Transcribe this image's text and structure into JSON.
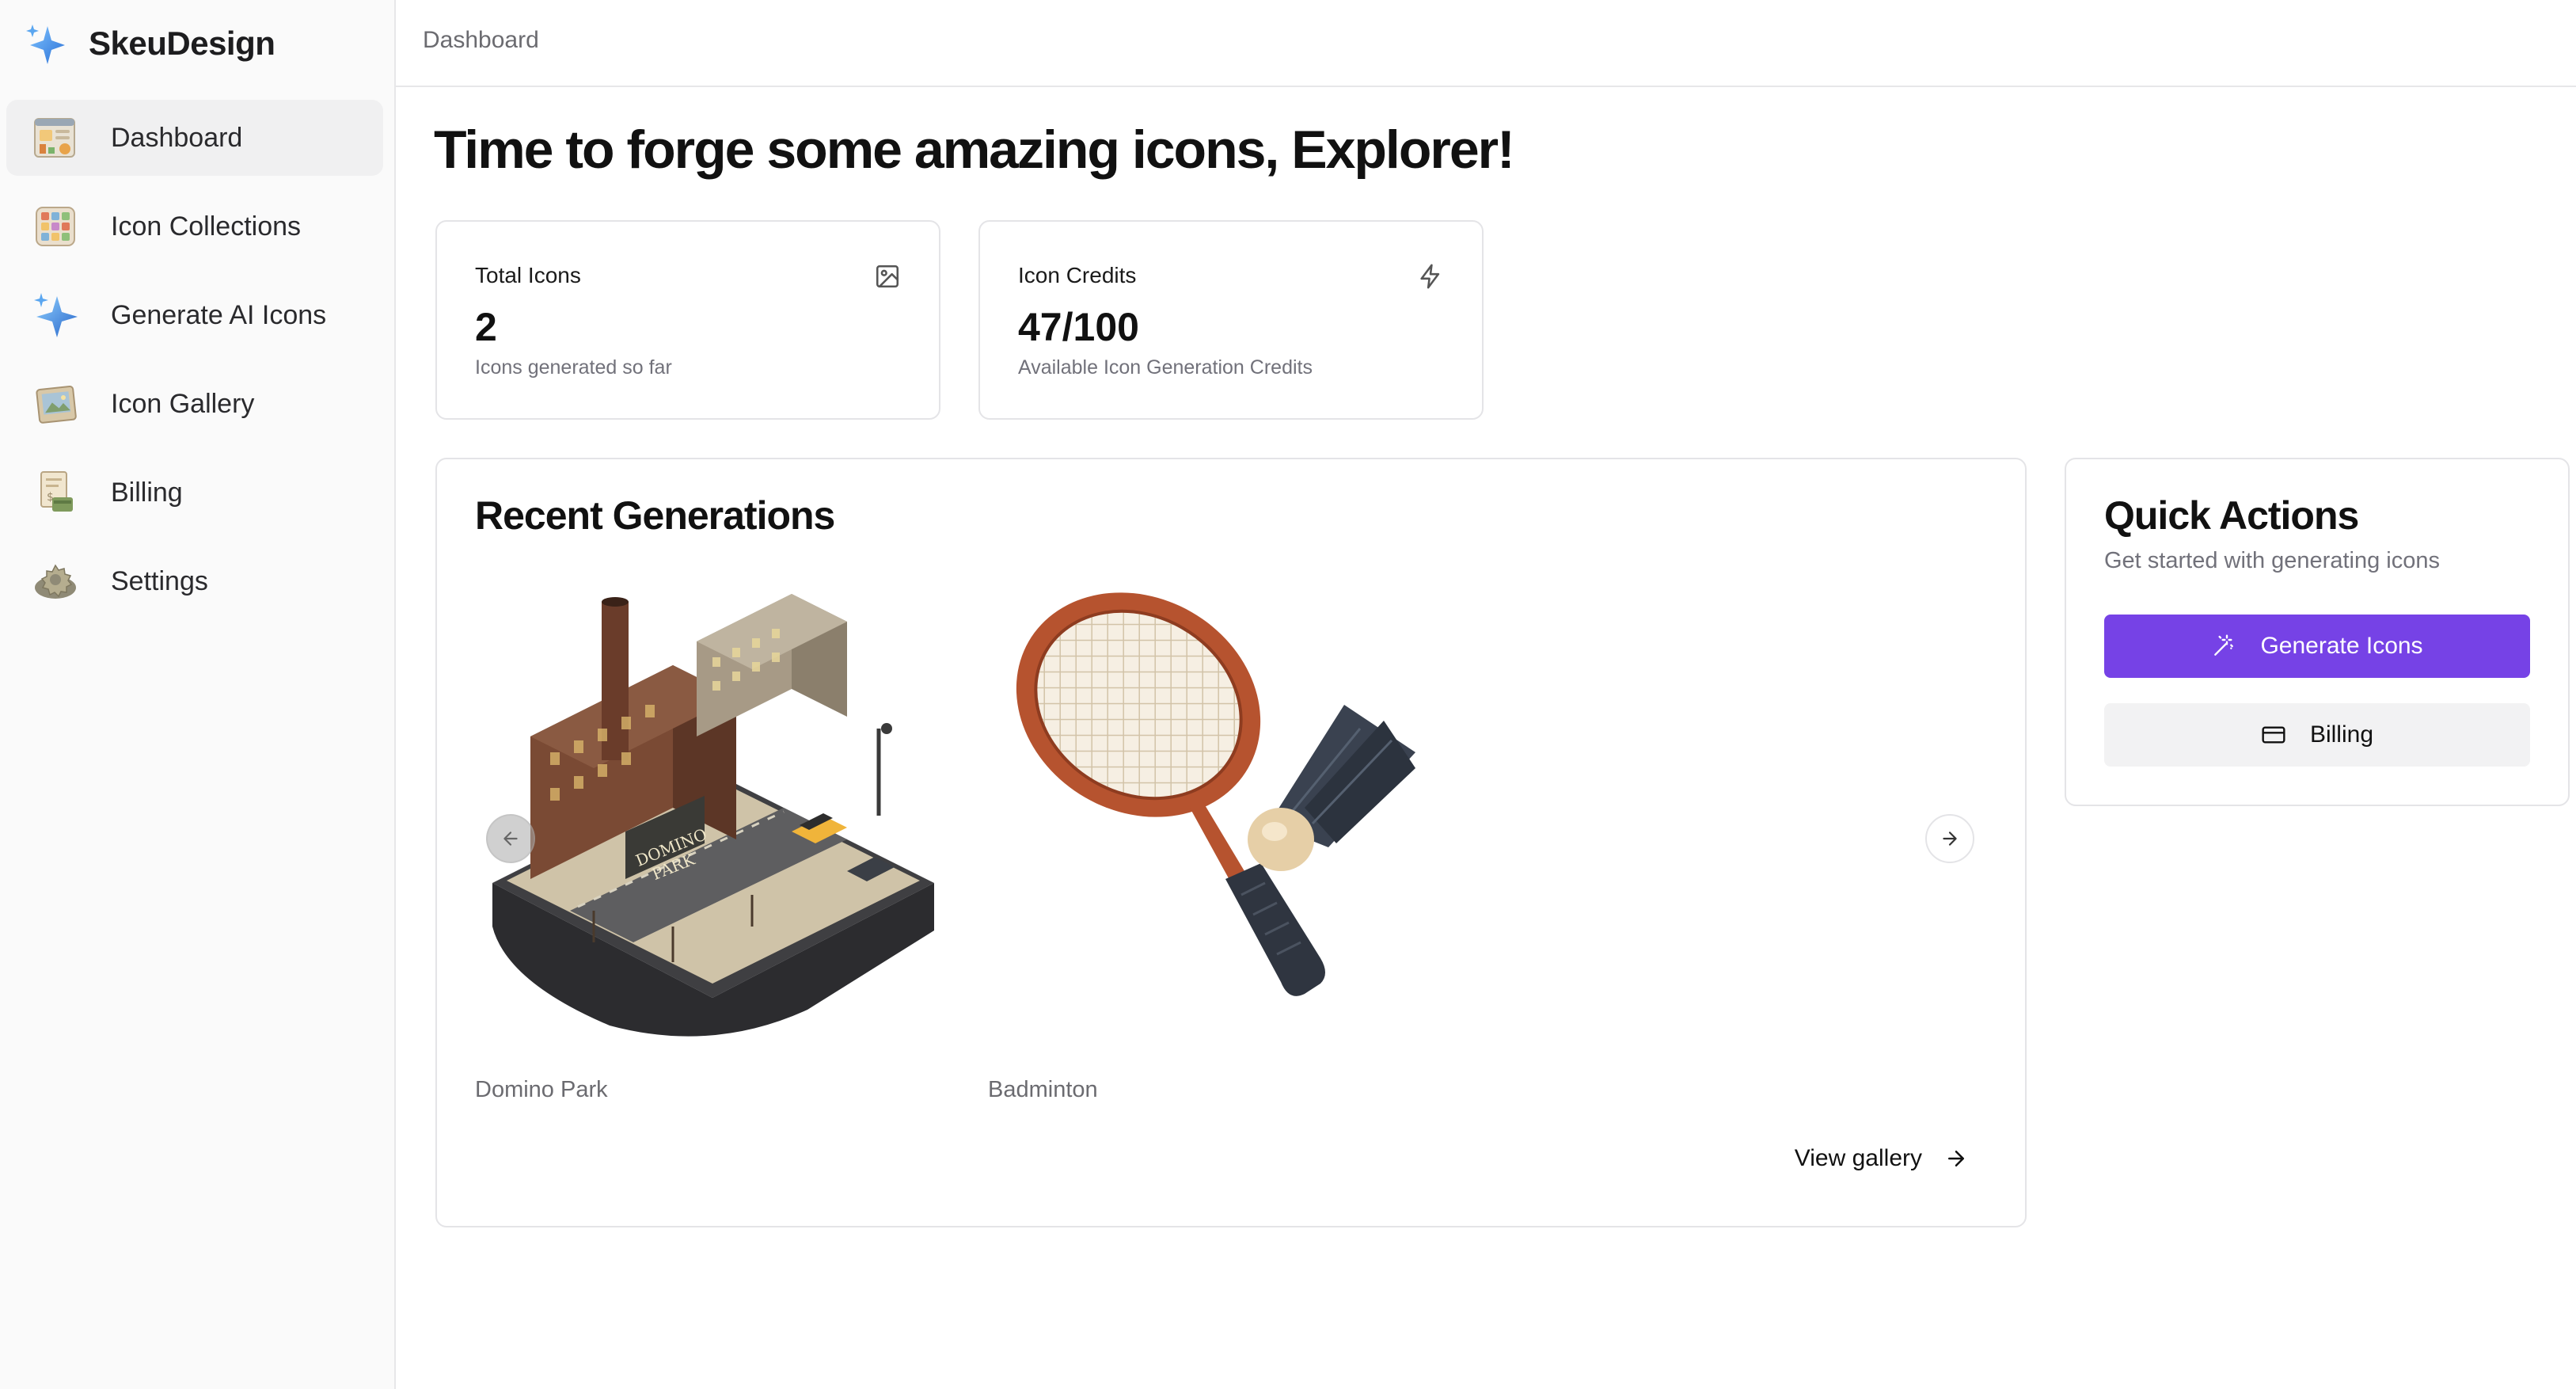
{
  "app": {
    "name": "SkeuDesign",
    "logo_icon": "sparkle-icon"
  },
  "sidebar": {
    "items": [
      {
        "label": "Dashboard",
        "icon": "dashboard-icon",
        "active": true
      },
      {
        "label": "Icon Collections",
        "icon": "collections-grid-icon",
        "active": false
      },
      {
        "label": "Generate AI Icons",
        "icon": "sparkle-icon",
        "active": false
      },
      {
        "label": "Icon Gallery",
        "icon": "picture-frame-icon",
        "active": false
      },
      {
        "label": "Billing",
        "icon": "billing-receipt-icon",
        "active": false
      },
      {
        "label": "Settings",
        "icon": "gear-icon",
        "active": false
      }
    ]
  },
  "header": {
    "breadcrumb": "Dashboard"
  },
  "main": {
    "greeting": "Time to forge some amazing icons, Explorer!",
    "stats": [
      {
        "title": "Total Icons",
        "value": "2",
        "subtitle": "Icons generated so far",
        "icon": "image-icon"
      },
      {
        "title": "Icon Credits",
        "value": "47/100",
        "subtitle": "Available Icon Generation Credits",
        "icon": "lightning-icon"
      }
    ],
    "recent": {
      "title": "Recent Generations",
      "items": [
        {
          "caption": "Domino Park",
          "image": "domino-park-city-block-image"
        },
        {
          "caption": "Badminton",
          "image": "badminton-racket-shuttlecock-image"
        }
      ],
      "view_gallery": "View gallery"
    },
    "quick_actions": {
      "title": "Quick Actions",
      "subtitle": "Get started with generating icons",
      "primary_button": "Generate Icons",
      "secondary_button": "Billing"
    }
  },
  "colors": {
    "accent": "#7642e6",
    "sidebar_bg": "#fafafa",
    "border": "#e4e4e7"
  }
}
